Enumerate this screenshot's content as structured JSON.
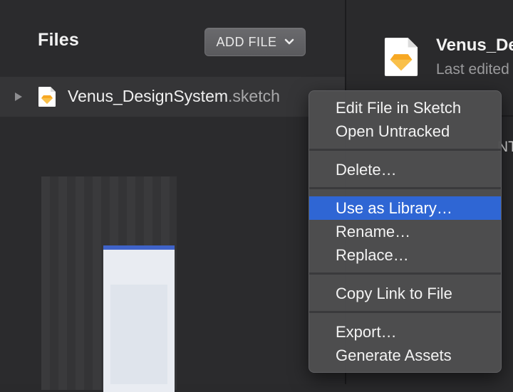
{
  "sidebar": {
    "title": "Files",
    "add_file_label": "ADD FILE",
    "file": {
      "name": "Venus_DesignSystem",
      "extension": ".sketch"
    }
  },
  "main": {
    "title": "Venus_De",
    "subtitle": "Last edited",
    "tab_fragment": "NT"
  },
  "context_menu": {
    "items": [
      {
        "label": "Edit File in Sketch"
      },
      {
        "label": "Open Untracked"
      },
      {
        "label": "Delete…"
      },
      {
        "label": "Use as Library…",
        "highlighted": true
      },
      {
        "label": "Rename…"
      },
      {
        "label": "Replace…"
      },
      {
        "label": "Copy Link to File"
      },
      {
        "label": "Export…"
      },
      {
        "label": "Generate Assets"
      }
    ]
  },
  "colors": {
    "sketch_diamond": "#f7a823",
    "highlight": "#2f66d4"
  },
  "icons": {
    "disclosure": "disclosure-triangle-icon",
    "chevron": "chevron-down-icon",
    "file": "sketch-file-icon"
  }
}
